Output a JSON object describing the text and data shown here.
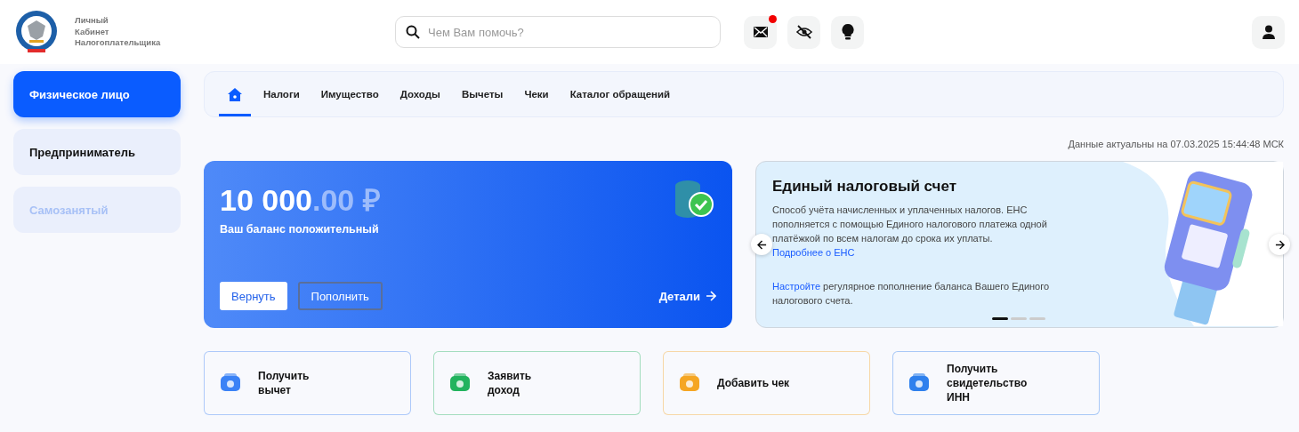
{
  "header": {
    "logo_text": [
      "Личный",
      "Кабинет",
      "Налогоплательщика"
    ],
    "search": {
      "placeholder": "Чем Вам помочь?"
    },
    "actions": [
      {
        "kind": "mail",
        "badge": true
      },
      {
        "kind": "hide",
        "badge": false
      },
      {
        "kind": "tip",
        "badge": false
      }
    ]
  },
  "sidebar": {
    "items": [
      {
        "label": "Физическое лицо",
        "selected": true,
        "disabled": false
      },
      {
        "label": "Предприниматель",
        "selected": false,
        "disabled": false
      },
      {
        "label": "Самозанятый",
        "selected": false,
        "disabled": true
      }
    ]
  },
  "nav": {
    "tabs": [
      {
        "kind": "home",
        "selected": true
      },
      {
        "kind": "text",
        "label": "Налоги",
        "selected": false
      },
      {
        "kind": "text",
        "label": "Имущество",
        "selected": false
      },
      {
        "kind": "text",
        "label": "Доходы",
        "selected": false
      },
      {
        "kind": "text",
        "label": "Вычеты",
        "selected": false
      },
      {
        "kind": "text",
        "label": "Чеки",
        "selected": false
      },
      {
        "kind": "text",
        "label": "Каталог обращений",
        "selected": false
      }
    ]
  },
  "updated": "Данные актуальны на 07.03.2025 15:44:48 МСК",
  "balance": {
    "amount": "10 000",
    "fraction": ".00 ₽",
    "status": "Ваш баланс положительный",
    "buttons": [
      {
        "kind": "primary",
        "label": "Вернуть"
      },
      {
        "kind": "outline",
        "label": "Пополнить"
      }
    ],
    "details": "Детали"
  },
  "carousel": {
    "title": "Единый налоговый счет",
    "paragraphs": [
      [
        {
          "kind": "text",
          "text": "Способ учёта начисленных и уплаченных налогов. ЕНС пополняется с помощью Единого налогового платежа одной платёжкой по всем налогам до срока их уплаты. "
        },
        {
          "kind": "link",
          "text": "Подробнее о ЕНС"
        }
      ],
      [
        {
          "kind": "link",
          "text": "Настройте"
        },
        {
          "kind": "text",
          "text": " регулярное пополнение баланса Вашего Единого налогового счета."
        }
      ]
    ],
    "dots": [
      {
        "selected": true
      },
      {
        "selected": false
      },
      {
        "selected": false
      }
    ]
  },
  "quick_actions": [
    {
      "label": "Получить вычет",
      "color": "#3b82f6"
    },
    {
      "label": "Заявить доход",
      "color": "#22b35e"
    },
    {
      "label": "Добавить чек",
      "color": "#f5a623"
    },
    {
      "label": "Получить свидетельство ИНН",
      "color": "#2f80ed"
    }
  ]
}
